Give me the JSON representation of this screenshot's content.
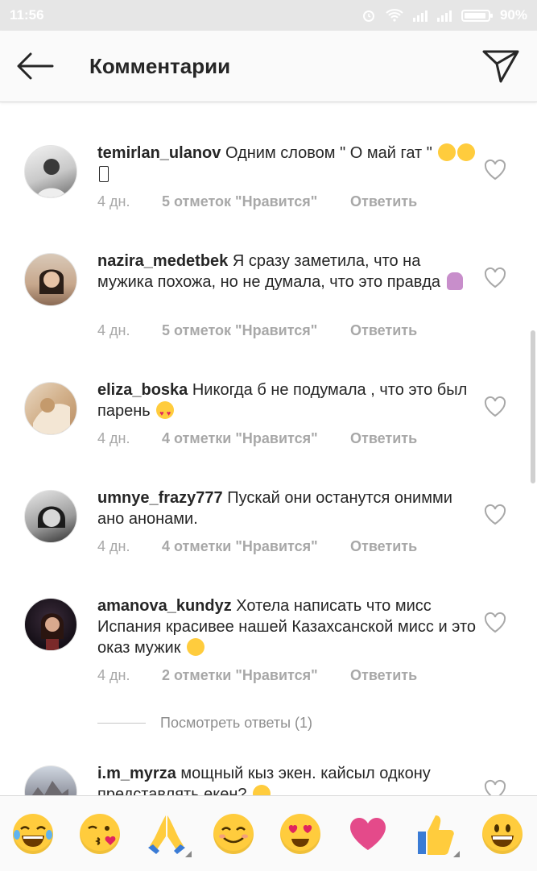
{
  "status_bar": {
    "time": "11:56",
    "battery": "90%"
  },
  "header": {
    "title": "Комментарии"
  },
  "comments": [
    {
      "username": "temirlan_ulanov",
      "text": "Одним словом \" О май  гат \"",
      "time": "4 дн.",
      "likes": "5 отметок \"Нравится\"",
      "reply": "Ответить"
    },
    {
      "username": "nazira_medetbek",
      "text": "Я сразу заметила, что на мужика похожа, но не думала, что это правда",
      "time": "4 дн.",
      "likes": "5 отметок \"Нравится\"",
      "reply": "Ответить"
    },
    {
      "username": "eliza_boska",
      "text": "Никогда б не подумала , что это был парень",
      "time": "4 дн.",
      "likes": "4 отметки \"Нравится\"",
      "reply": "Ответить"
    },
    {
      "username": "umnye_frazy777",
      "text": "Пускай они останутся онимми ано анонами.",
      "time": "4 дн.",
      "likes": "4 отметки \"Нравится\"",
      "reply": "Ответить"
    },
    {
      "username": "amanova_kundyz",
      "text": "Хотела написать что мисс Испания красивее нашей Казахсанской мисс и это оказ мужик",
      "time": "4 дн.",
      "likes": "2 отметки \"Нравится\"",
      "reply": "Ответить"
    },
    {
      "username": "i.m_myrza",
      "text": "мощный кыз экен. кайсыл одкону представлять екен?"
    }
  ],
  "view_replies": "Посмотреть ответы (1)",
  "emoji_bar": [
    "face-tears-of-joy",
    "face-blowing-kiss",
    "folded-hands",
    "smiling-face",
    "heart-eyes",
    "pink-heart",
    "thumbs-up",
    "grinning-face"
  ],
  "colors": {
    "text": "#262626",
    "meta": "#a8a8a8",
    "status_bar": "#e6e6e6",
    "header_bg": "#fafafa",
    "emoji_yellow": "#ffcc3d",
    "pink_heart": "#e44a8a"
  }
}
